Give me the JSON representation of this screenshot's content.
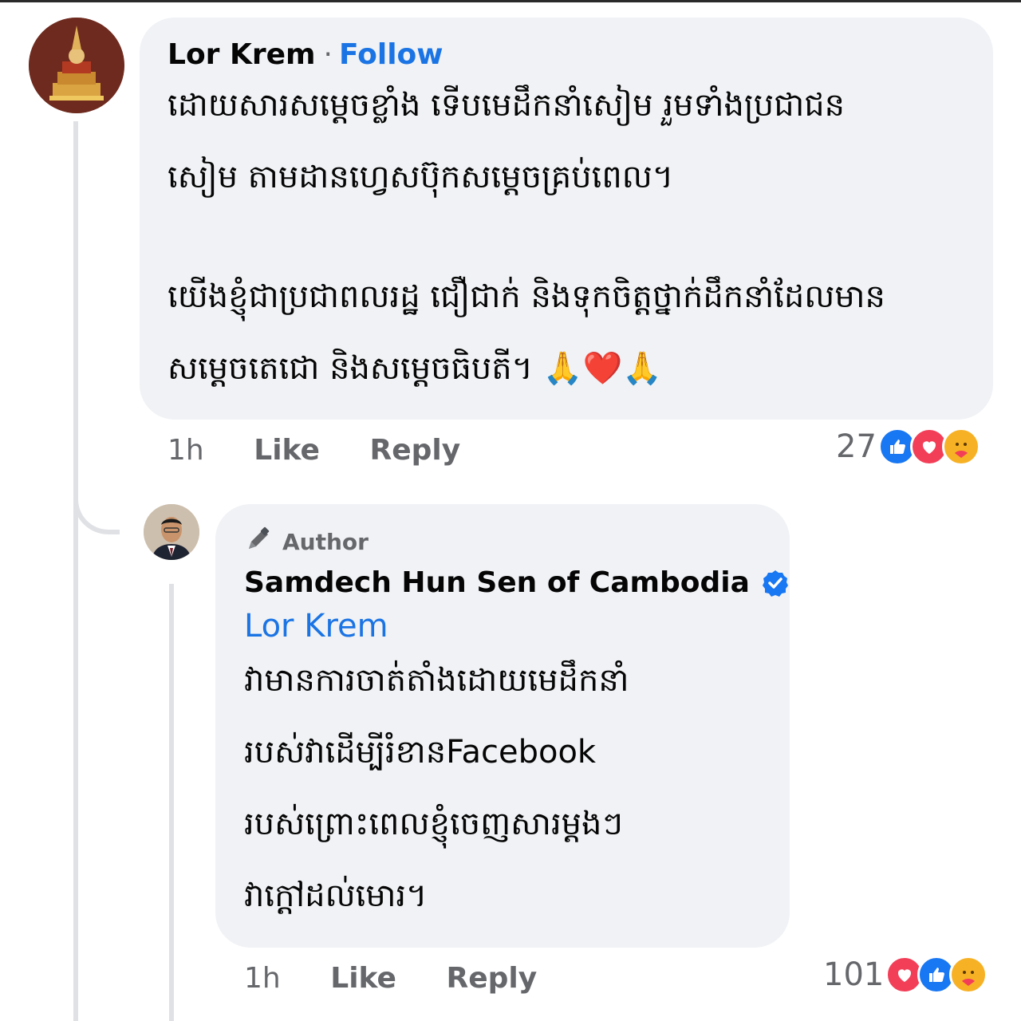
{
  "comment": {
    "author": "Lor Krem",
    "separator": "·",
    "follow_label": "Follow",
    "text_lines": [
      "ដោយសារសម្តេចខ្លាំង ទើបមេដឹកនាំសៀម រួមទាំងប្រជាជន",
      "សៀម តាមដានហ្វេសប៊ុកសម្តេចគ្រប់ពេល។",
      "យើងខ្ញុំជាប្រជាពលរដ្ឋ ជឿជាក់ និងទុកចិត្តថ្នាក់ដឹកនាំដែលមាន",
      "សម្តេចតេជោ និងសម្តេចធិបតី។"
    ],
    "emoji": "🙏❤️🙏",
    "time": "1h",
    "like_label": "Like",
    "reply_label": "Reply",
    "reaction_count": "27",
    "reactions": [
      "like-icon",
      "love-icon",
      "care-icon"
    ]
  },
  "reply": {
    "badge_label": "Author",
    "author": "Samdech Hun Sen of Cambodia",
    "mention": "Lor Krem",
    "text_lines": [
      "វាមានការចាត់តាំងដោយមេដឹកនាំ",
      "របស់វាដើម្បីរំខានFacebook",
      "របស់ព្រោះពេលខ្ញុំចេញសារម្តងៗ",
      "វាក្តៅដល់មោរ។"
    ],
    "time": "1h",
    "like_label": "Like",
    "reply_label": "Reply",
    "reaction_count": "101",
    "reactions": [
      "love-icon",
      "like-icon",
      "care-icon"
    ]
  },
  "colors": {
    "bubble": "#f0f2f5",
    "link": "#1b74e4",
    "meta": "#65676b",
    "verified": "#1877f2"
  }
}
